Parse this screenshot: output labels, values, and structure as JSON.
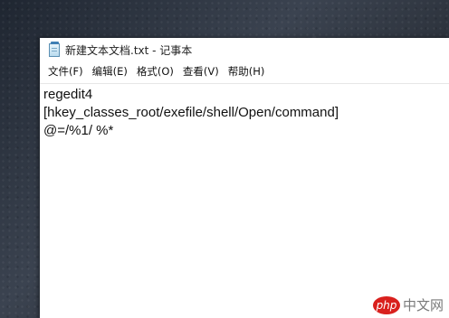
{
  "window": {
    "title": "新建文本文档.txt - 记事本",
    "icon": "notepad-icon"
  },
  "menu": [
    {
      "label": "文件(F)"
    },
    {
      "label": "编辑(E)"
    },
    {
      "label": "格式(O)"
    },
    {
      "label": "查看(V)"
    },
    {
      "label": "帮助(H)"
    }
  ],
  "editor": {
    "lines": [
      "regedit4",
      "[hkey_classes_root/exefile/shell/Open/command]",
      "@=/%1/ %*"
    ]
  },
  "watermark": {
    "logo_text": "php",
    "text": "中文网"
  }
}
